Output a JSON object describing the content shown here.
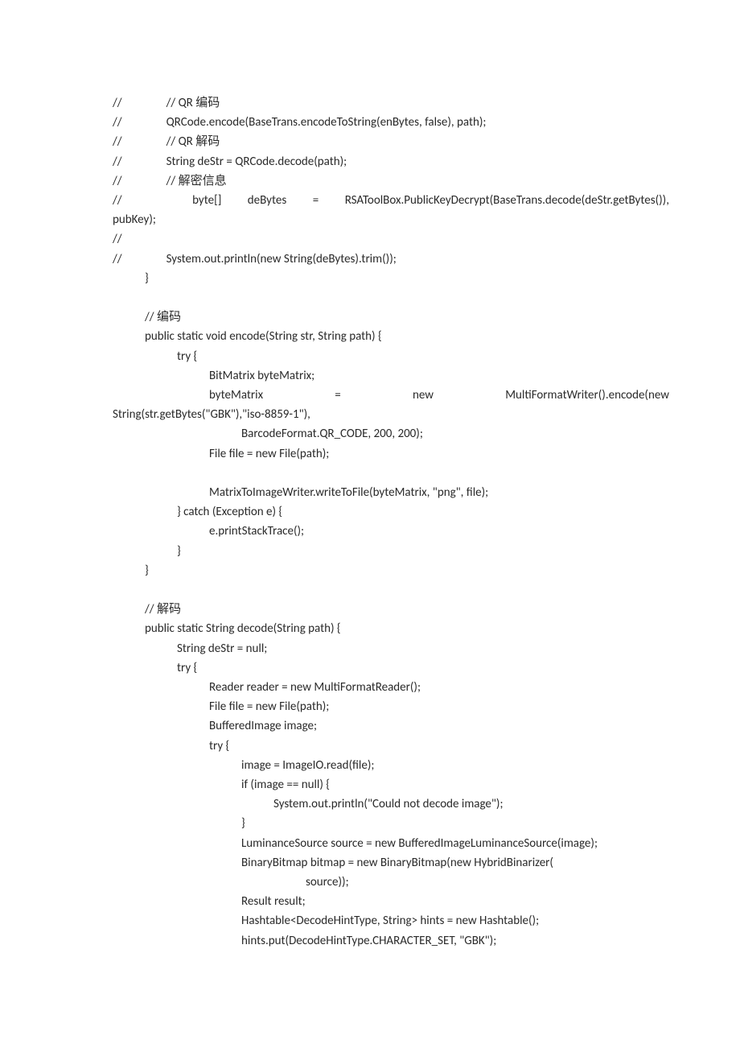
{
  "lines": {
    "l1": "//",
    "l1b": "// QR 编码",
    "l2": "//",
    "l2b": "QRCode.encode(BaseTrans.encodeToString(enBytes, false), path);",
    "l3": "//",
    "l3b": "// QR 解码",
    "l4": "//",
    "l4b": "String deStr = QRCode.decode(path);",
    "l5": "//",
    "l5b": "// 解密信息",
    "l6a": "//",
    "l6b": "byte[]",
    "l6c": "deBytes",
    "l6d": "=",
    "l6e": "RSAToolBox.PublicKeyDecrypt(BaseTrans.decode(deStr.getBytes()),",
    "l7": "pubKey);",
    "l8": "//",
    "l9": "//",
    "l9b": "System.out.println(new String(deBytes).trim());",
    "l10": "}",
    "l11": "// 编码",
    "l12": "public static void encode(String str, String path) {",
    "l13": "try {",
    "l14": "BitMatrix byteMatrix;",
    "l15a": "byteMatrix",
    "l15b": "=",
    "l15c": "new",
    "l15d": "MultiFormatWriter().encode(new",
    "l16": "String(str.getBytes(\"GBK\"),\"iso-8859-1\"),",
    "l17": "BarcodeFormat.QR_CODE, 200, 200);",
    "l18": "File file = new File(path);",
    "l19": "MatrixToImageWriter.writeToFile(byteMatrix, \"png\", file);",
    "l20": "} catch (Exception e) {",
    "l21": "e.printStackTrace();",
    "l22": "}",
    "l23": "}",
    "l24": "// 解码",
    "l25": "public static String decode(String path) {",
    "l26": "String deStr = null;",
    "l27": "try {",
    "l28": "Reader reader = new MultiFormatReader();",
    "l29": "File file = new File(path);",
    "l30": "BufferedImage image;",
    "l31": "try {",
    "l32": "image = ImageIO.read(file);",
    "l33": "if (image == null) {",
    "l34": "System.out.println(\"Could not decode image\");",
    "l35": "}",
    "l36": "LuminanceSource source = new BufferedImageLuminanceSource(image);",
    "l37": "BinaryBitmap bitmap = new BinaryBitmap(new HybridBinarizer(",
    "l38": "source));",
    "l39": "Result result;",
    "l40": "Hashtable<DecodeHintType, String> hints = new Hashtable();",
    "l41": "hints.put(DecodeHintType.CHARACTER_SET, \"GBK\");"
  }
}
